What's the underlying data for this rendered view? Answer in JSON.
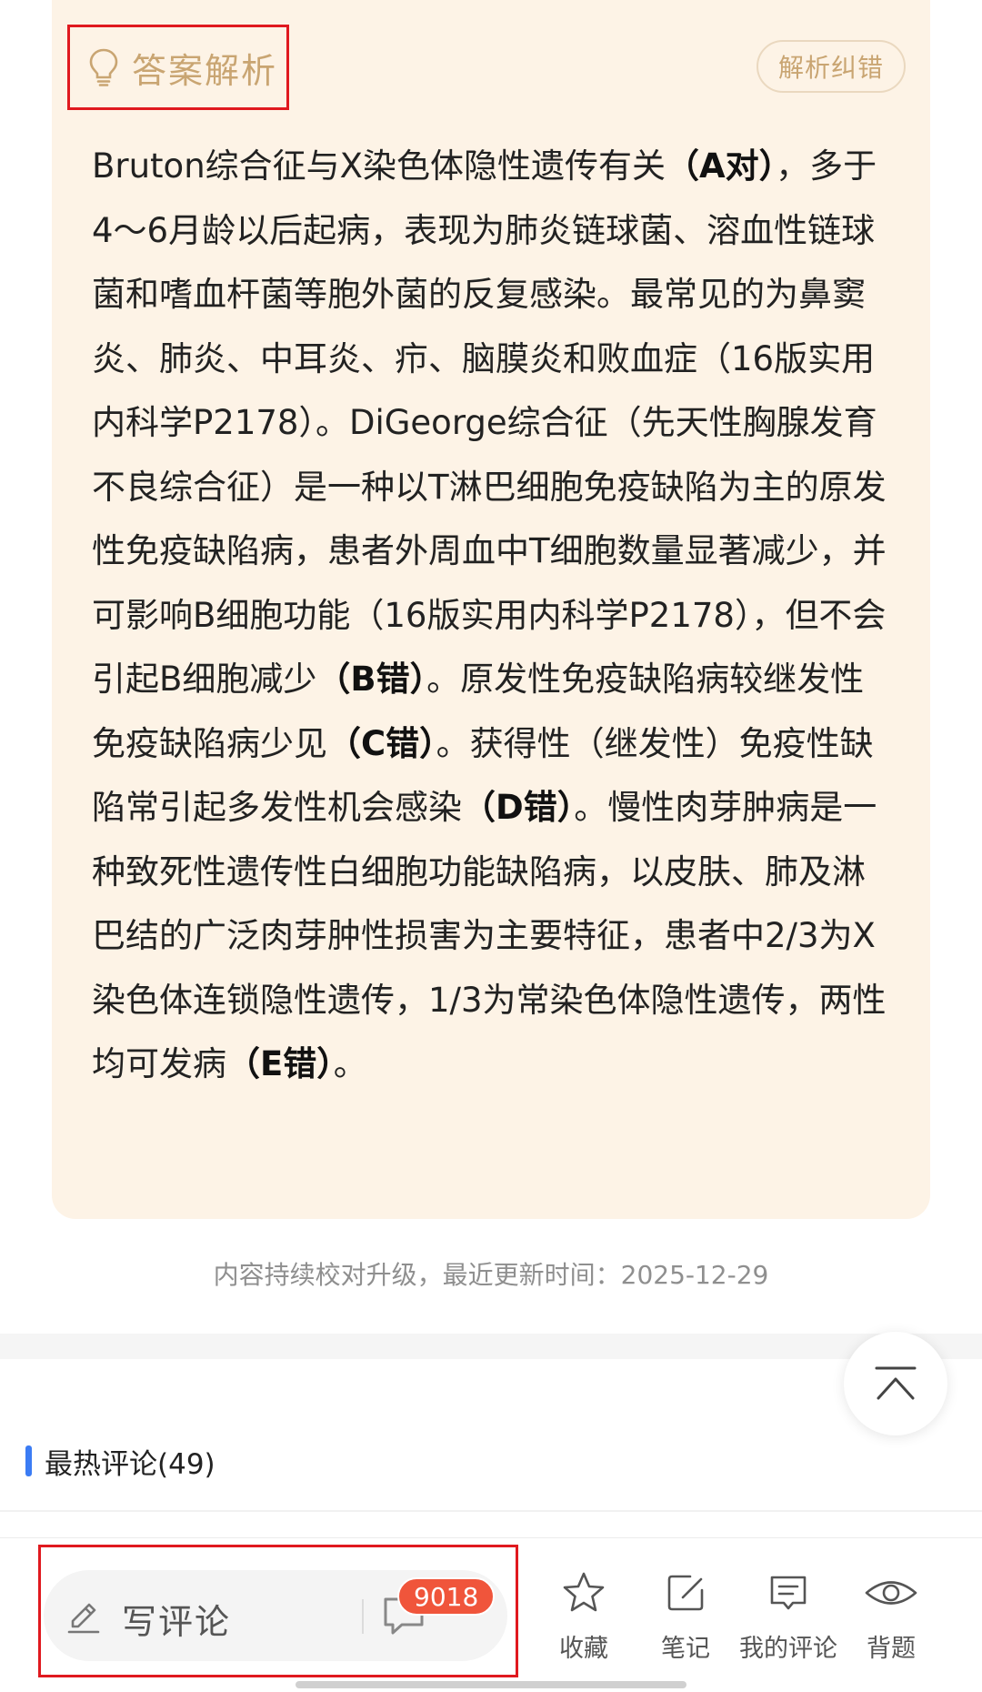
{
  "analysis": {
    "title": "答案解析",
    "correction_button": "解析纠错",
    "segments": [
      {
        "text": "Bruton综合征与X染色体隐性遗传有关",
        "bold": false
      },
      {
        "text": "（A对）",
        "bold": true
      },
      {
        "text": "，多于4～6月龄以后起病，表现为肺炎链球菌、溶血性链球菌和嗜血杆菌等胞外菌的反复感染。最常见的为鼻窦炎、肺炎、中耳炎、疖、脑膜炎和败血症（16版实用内科学P2178）。DiGeorge综合征（先天性胸腺发育不良综合征）是一种以T淋巴细胞免疫缺陷为主的原发性免疫缺陷病，患者外周血中T细胞数量显著减少，并可影响B细胞功能（16版实用内科学P2178），但不会引起B细胞减少",
        "bold": false
      },
      {
        "text": "（B错）",
        "bold": true
      },
      {
        "text": "。原发性免疫缺陷病较继发性免疫缺陷病少见",
        "bold": false
      },
      {
        "text": "（C错）",
        "bold": true
      },
      {
        "text": "。获得性（继发性）免疫性缺陷常引起多发性机会感染",
        "bold": false
      },
      {
        "text": "（D错）",
        "bold": true
      },
      {
        "text": "。慢性肉芽肿病是一种致死性遗传性白细胞功能缺陷病，以皮肤、肺及淋巴结的广泛肉芽肿性损害为主要特征，患者中2/3为X染色体连锁隐性遗传，1/3为常染色体隐性遗传，两性均可发病",
        "bold": false
      },
      {
        "text": "（E错）",
        "bold": true
      },
      {
        "text": "。",
        "bold": false
      }
    ]
  },
  "update_note": "内容持续校对升级，最近更新时间：2025-12-29",
  "comments": {
    "hot_label": "最热评论(49)"
  },
  "bottom_bar": {
    "comment_placeholder": "写评论",
    "comment_count": "9018",
    "items": [
      {
        "label": "收藏",
        "icon": "star-icon"
      },
      {
        "label": "笔记",
        "icon": "note-edit-icon"
      },
      {
        "label": "我的评论",
        "icon": "my-comment-icon"
      },
      {
        "label": "背题",
        "icon": "eye-icon"
      }
    ]
  },
  "colors": {
    "card_background": "#fdf3e6",
    "gold_accent": "#c9a572",
    "highlight_border": "#e0191f",
    "badge": "#f0553b",
    "accent_bar": "#3b7cf4"
  }
}
